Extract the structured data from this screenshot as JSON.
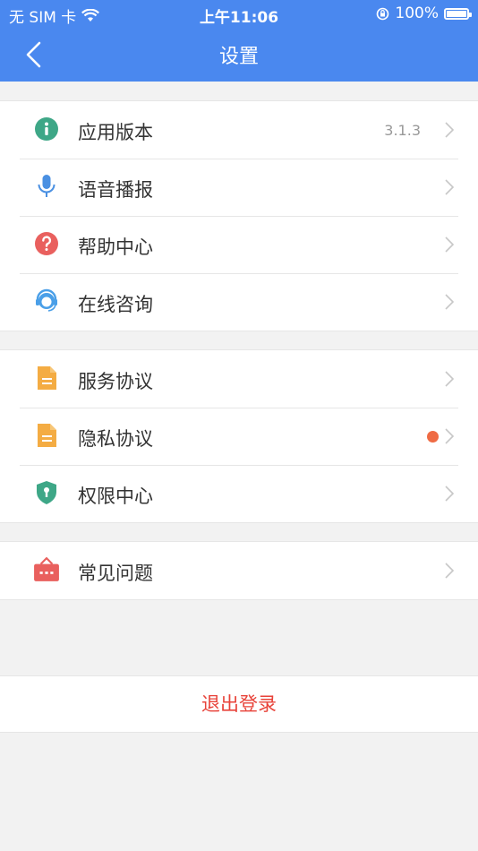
{
  "status_bar": {
    "carrier": "无 SIM 卡",
    "time": "上午11:06",
    "battery": "100%"
  },
  "header": {
    "title": "设置"
  },
  "groups": [
    {
      "items": [
        {
          "label": "应用版本",
          "value": "3.1.3",
          "icon": "info-icon"
        },
        {
          "label": "语音播报",
          "icon": "microphone-icon"
        },
        {
          "label": "帮助中心",
          "icon": "question-icon"
        },
        {
          "label": "在线咨询",
          "icon": "customer-service-icon"
        }
      ]
    },
    {
      "items": [
        {
          "label": "服务协议",
          "icon": "document-icon"
        },
        {
          "label": "隐私协议",
          "icon": "document-icon",
          "badge_color": "#ef6b44"
        },
        {
          "label": "权限中心",
          "icon": "shield-icon"
        }
      ]
    },
    {
      "items": [
        {
          "label": "常见问题",
          "icon": "chat-box-icon"
        }
      ]
    }
  ],
  "logout": {
    "label": "退出登录"
  },
  "colors": {
    "header_bg": "#4a88ef",
    "logout_text": "#e8433a",
    "badge": "#ef6b44"
  }
}
